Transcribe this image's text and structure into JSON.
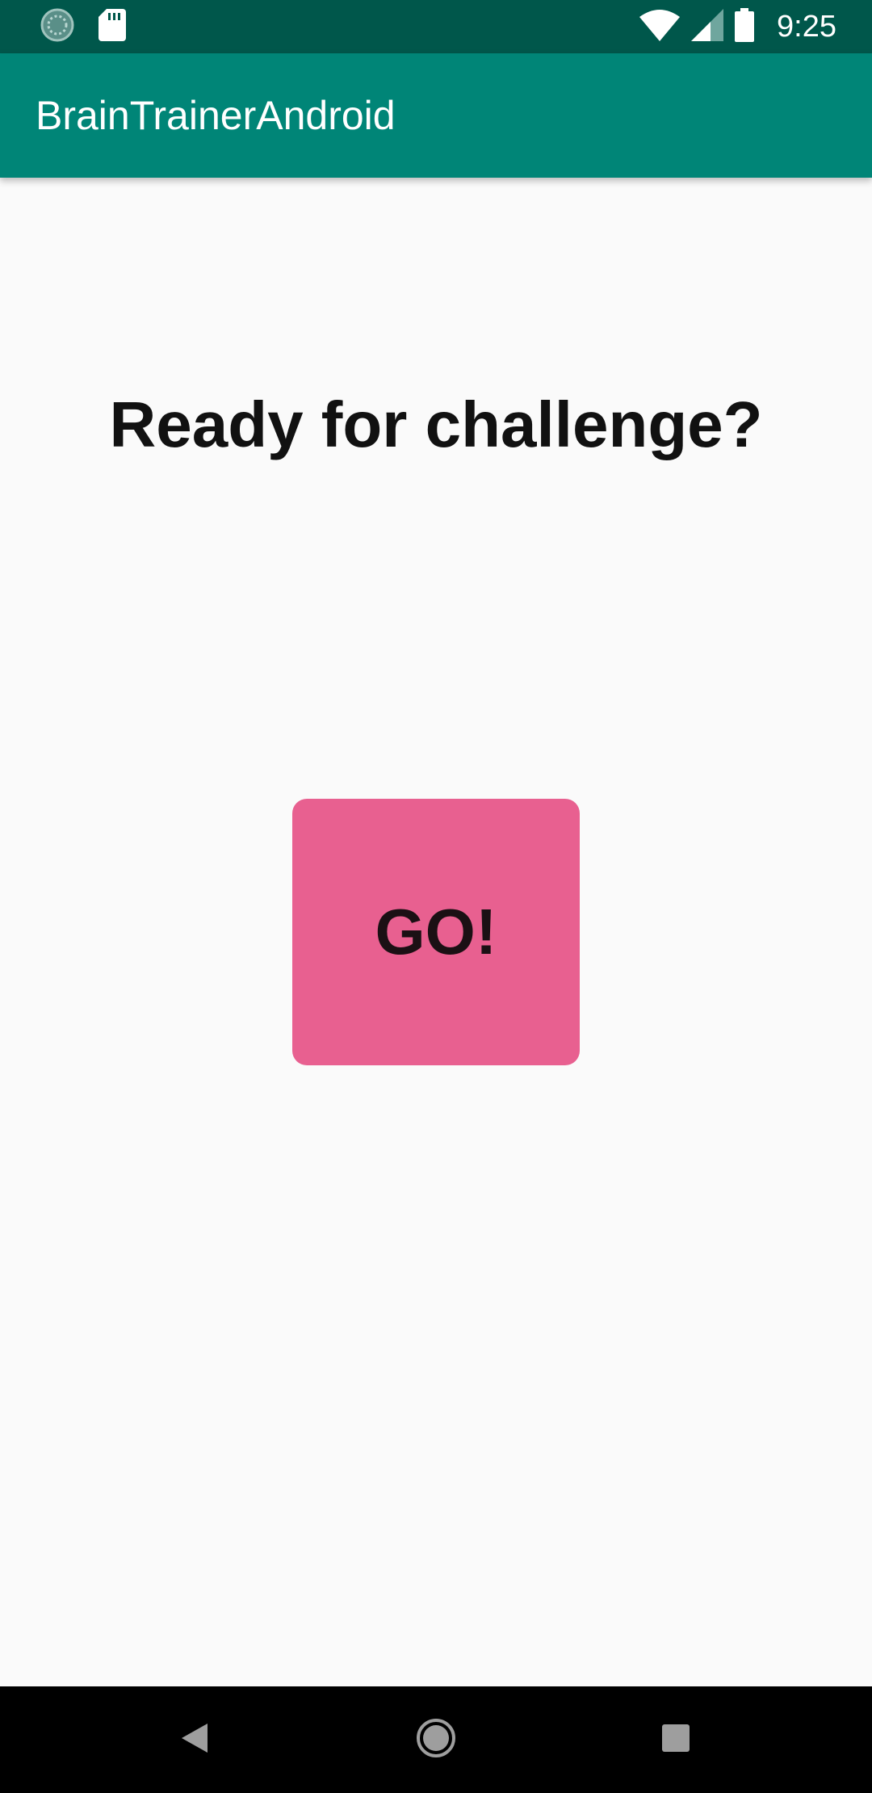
{
  "status_bar": {
    "time": "9:25",
    "left_icons": [
      "sync-icon",
      "sd-card-icon"
    ],
    "right_icons": [
      "wifi-icon",
      "signal-icon",
      "battery-icon"
    ],
    "background": "#00574b"
  },
  "app_bar": {
    "title": "BrainTrainerAndroid",
    "background": "#008577"
  },
  "main": {
    "headline": "Ready for challenge?",
    "go_button_label": "GO!",
    "go_button_color": "#e86090"
  },
  "nav_bar": {
    "buttons": [
      "back-icon",
      "home-icon",
      "recents-icon"
    ]
  }
}
